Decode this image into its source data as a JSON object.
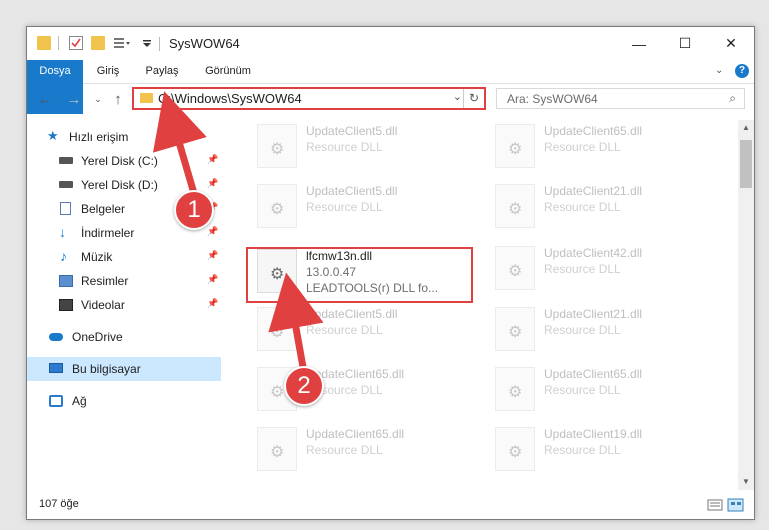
{
  "window": {
    "title": "SysWOW64",
    "controls": {
      "minimize": "—",
      "maximize": "☐",
      "close": "✕"
    }
  },
  "ribbon": {
    "tabs": [
      "Dosya",
      "Giriş",
      "Paylaş",
      "Görünüm"
    ],
    "expand_icon": "chevron-down-icon",
    "help_icon": "help-icon"
  },
  "navigation": {
    "address": "C:\\Windows\\SysWOW64",
    "search_placeholder": "Ara: SysWOW64"
  },
  "sidebar": {
    "quick_access": "Hızlı erişim",
    "quick_items": [
      {
        "label": "Yerel Disk (C:)",
        "icon": "drive-icon"
      },
      {
        "label": "Yerel Disk (D:)",
        "icon": "drive-icon"
      },
      {
        "label": "Belgeler",
        "icon": "documents-icon"
      },
      {
        "label": "İndirmeler",
        "icon": "downloads-icon"
      },
      {
        "label": "Müzik",
        "icon": "music-icon"
      },
      {
        "label": "Resimler",
        "icon": "pictures-icon"
      },
      {
        "label": "Videolar",
        "icon": "videos-icon"
      }
    ],
    "onedrive": "OneDrive",
    "this_pc": "Bu bilgisayar",
    "network": "Ağ"
  },
  "files": {
    "left_column": [
      {
        "name": "UpdateClient5.dll",
        "desc": "Resource DLL"
      },
      {
        "name": "UpdateClient5.dll",
        "desc": "Resource DLL"
      },
      {
        "name": "lfcmw13n.dll",
        "version": "13.0.0.47",
        "desc": "LEADTOOLS(r) DLL fo..."
      },
      {
        "name": "UpdateClient5.dll",
        "desc": "Resource DLL"
      },
      {
        "name": "UpdateClient65.dll",
        "desc": "Resource DLL"
      },
      {
        "name": "UpdateClient65.dll",
        "desc": "Resource DLL"
      }
    ],
    "right_column": [
      {
        "name": "UpdateClient65.dll",
        "desc": "Resource DLL"
      },
      {
        "name": "UpdateClient21.dll",
        "desc": "Resource DLL"
      },
      {
        "name": "UpdateClient42.dll",
        "desc": "Resource DLL"
      },
      {
        "name": "UpdateClient21.dll",
        "desc": "Resource DLL"
      },
      {
        "name": "UpdateClient65.dll",
        "desc": "Resource DLL"
      },
      {
        "name": "UpdateClient19.dll",
        "desc": "Resource DLL"
      }
    ]
  },
  "status": {
    "item_count": "107 öğe"
  },
  "annotations": {
    "marker1": "1",
    "marker2": "2",
    "color": "#e04040"
  }
}
